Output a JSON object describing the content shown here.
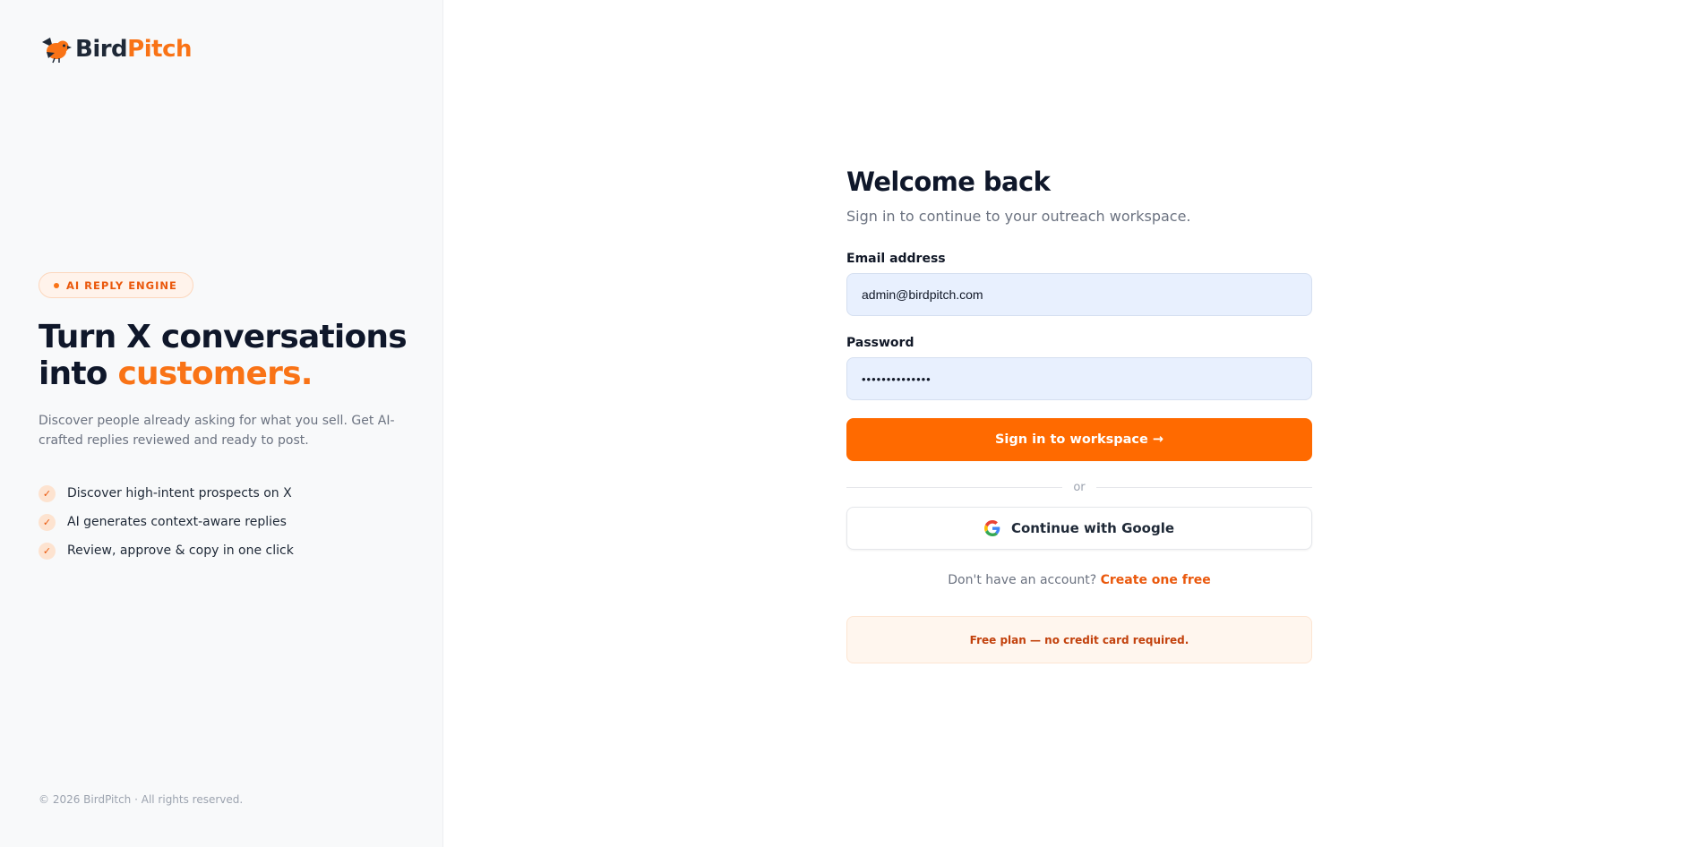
{
  "brand": {
    "name_part1": "Bird",
    "name_part2": "Pitch"
  },
  "left": {
    "badge": "AI REPLY ENGINE",
    "headline_line1": "Turn X conversations",
    "headline_line2_plain": "into ",
    "headline_line2_accent": "customers.",
    "description": "Discover people already asking for what you sell. Get AI-crafted replies reviewed and ready to post.",
    "features": [
      "Discover high-intent prospects on X",
      "AI generates context-aware replies",
      "Review, approve & copy in one click"
    ],
    "copyright": "© 2026 BirdPitch · All rights reserved."
  },
  "form": {
    "title": "Welcome back",
    "subtitle": "Sign in to continue to your outreach workspace.",
    "email_label": "Email address",
    "email_value": "admin@birdpitch.com",
    "password_label": "Password",
    "password_value": "••••••••••••••",
    "submit_label": "Sign in to workspace →",
    "divider_text": "or",
    "google_label": "Continue with Google",
    "signup_prompt": "Don't have an account?",
    "signup_link": "Create one free",
    "note": "Free plan — no credit card required."
  },
  "colors": {
    "accent": "#f97316",
    "primary_button": "#ff6a00",
    "input_background": "#e8f0fe"
  }
}
